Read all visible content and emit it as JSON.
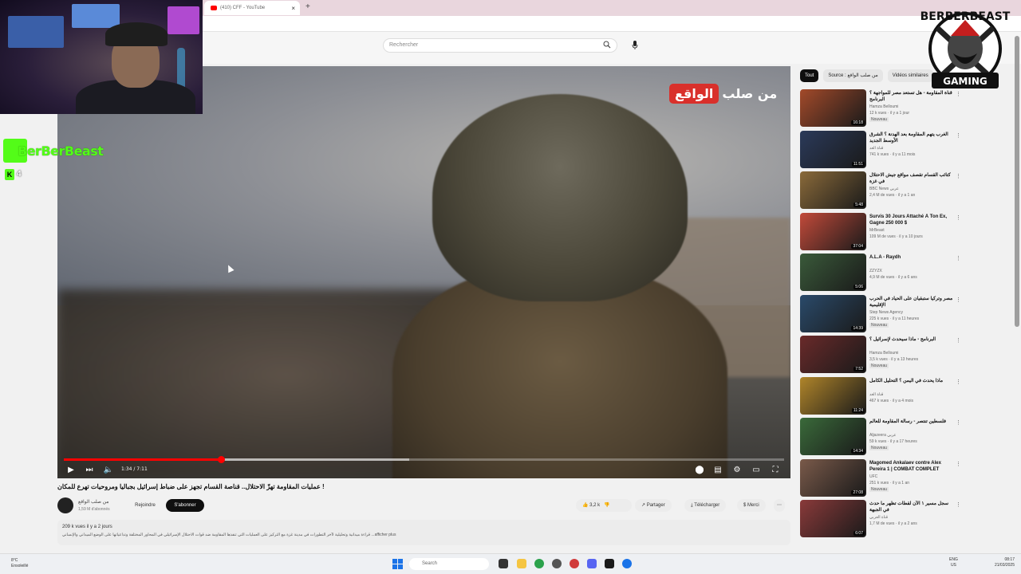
{
  "browser": {
    "tab_title": "(410) CFF - YouTube",
    "tab_close": "×",
    "new_tab": "+"
  },
  "youtube": {
    "search_placeholder": "Rechercher"
  },
  "player": {
    "channel_watermark_red": "الواقع",
    "channel_watermark_white": "من صلب",
    "time": "1:34 / 7:11",
    "progress_played": 0.218,
    "progress_loaded": 0.48
  },
  "video": {
    "title": "! عمليات المقاومة تهزّ الاحتلال.. قناصة القسام تجهز على ضباط إسرائيل بجباليا ومروحيات تهرع للمكان",
    "channel_name": "من صلب الواقع",
    "channel_subs": "1,59 M d'abonnés",
    "join_label": "Rejoindre",
    "subscribe_label": "S'abonner",
    "likes": "3,2 k",
    "share_label": "Partager",
    "download_label": "Télécharger",
    "thanks_label": "Merci",
    "more_label": "⋯",
    "views_date": "209 k vues  il y a 2 jours",
    "description": "قراءة ميدانية وتحليلية لآخر التطورات في مدينة غزة مع التركيز على العمليات التي تنفذها المقاومة ضد قوات الاحتلال الإسرائيلي في المحاور المختلفة وتداعياتها على الوضع الميداني والإنساني ...afficher plus"
  },
  "sidebar": {
    "chips": [
      "Tout",
      "Source : من صلب الواقع",
      "Vidéos similaires"
    ],
    "items": [
      {
        "title": "قناة المقاومة - هل تستعد مصر للمواجهة ؟ البرنامج",
        "channel": "Hamza Belloumi",
        "views": "12 k vues · il y a 1 jour",
        "badge": "Nouveau",
        "duration": "16:18",
        "menu": "⋮"
      },
      {
        "title": "الغرب يتهم المقاومة بعد الهدنة ؟ الشرق الأوسط الجديد",
        "channel": "قناة الغد",
        "views": "741 k vues · il y a 11 mois",
        "badge": "",
        "duration": "11:51",
        "menu": "⋮"
      },
      {
        "title": "كتائب القسام تقصف مواقع جيش الاحتلال في غزة",
        "channel": "BBC News عربي",
        "views": "2,4 M de vues · il y a 1 an",
        "badge": "",
        "duration": "5:48",
        "menu": "⋮"
      },
      {
        "title": "Survis 30 Jours Attaché À Ton Ex, Gagne 250 000 $",
        "channel": "MrBeast",
        "views": "109 M de vues · il y a 10 jours",
        "badge": "",
        "duration": "37:04",
        "menu": "⋮"
      },
      {
        "title": "A.L.A - Raydh",
        "channel": "ZZYZX",
        "views": "4,9 M de vues · il y a 6 ans",
        "badge": "",
        "duration": "5:06",
        "menu": "⋮"
      },
      {
        "title": "مصر وتركيا ستبقيان على الحياد في الحرب الإقليمية",
        "channel": "Step News Agency",
        "views": "225 k vues · il y a 11 heures",
        "badge": "Nouveau",
        "duration": "14:39",
        "menu": "⋮"
      },
      {
        "title": "البرنامج - ماذا سيحدث لإسرائيل ؟",
        "channel": "Hamza Belloumi",
        "views": "3,5 k vues · il y a 13 heures",
        "badge": "Nouveau",
        "duration": "7:52",
        "menu": "⋮"
      },
      {
        "title": "ماذا يحدث في اليمن ؟ التحليل الكامل",
        "channel": "قناة الغد",
        "views": "467 k vues · il y a 4 mois",
        "badge": "",
        "duration": "11:24",
        "menu": "⋮"
      },
      {
        "title": "فلسطين تنتصر - رسالة المقاومة للعالم",
        "channel": "Aljazeera عربي",
        "views": "59 k vues · il y a 17 heures",
        "badge": "Nouveau",
        "duration": "14:34",
        "menu": "⋮"
      },
      {
        "title": "Magomed Ankalaev contre Alex Pereira 1 | COMBAT COMPLET",
        "channel": "UFC",
        "views": "251 k vues · il y a 1 an",
        "badge": "Nouveau",
        "duration": "27:08",
        "menu": "⋮"
      },
      {
        "title": "سجل مسير ١ الآن لقطات تظهر ما حدث في الجبهة",
        "channel": "قناة العربي",
        "views": "1,7 M de vues · il y a 2 ans",
        "badge": "",
        "duration": "6:07",
        "menu": "⋮"
      }
    ]
  },
  "overlay": {
    "kick_name": "BerBerBeast",
    "viewer_count": "4",
    "viewer_k": "K",
    "brand_top": "BERBERBEAST",
    "brand_bottom": "GAMING"
  },
  "taskbar": {
    "weather_temp": "8°C",
    "weather_text": "Ensoleillé",
    "search_placeholder": "Search",
    "lang": "ENG",
    "lang_sub": "US",
    "time": "08:17",
    "date": "21/03/2025"
  },
  "colors": {
    "kick_green": "#53fc18",
    "yt_red": "#ff0000",
    "watermark_red": "#d9302b"
  }
}
